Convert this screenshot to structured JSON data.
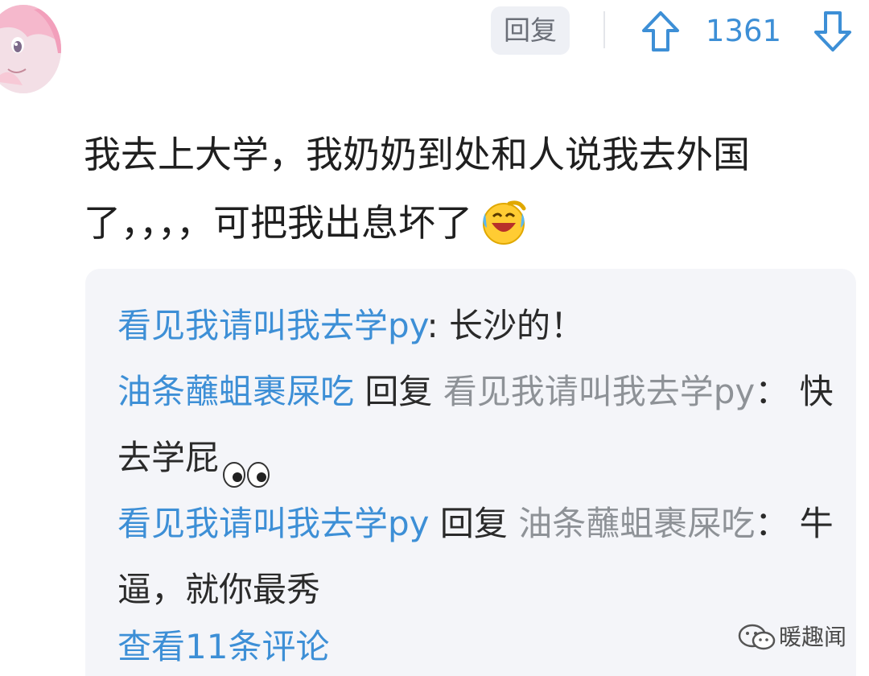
{
  "header": {
    "reply_label": "回复",
    "vote_count": "1361",
    "icons": {
      "avatar": "anime-avatar-pink-hair",
      "upvote": "arrow-up-icon",
      "downvote": "arrow-down-icon"
    }
  },
  "comment": {
    "text": "我去上大学，我奶奶到处和人说我去外国了，，，，可把我出息坏了",
    "emoji": "laughing-tears-emoji"
  },
  "replies": [
    {
      "user": "看见我请叫我去学py",
      "reply_word": "",
      "target": "",
      "text": ":  长沙的！"
    },
    {
      "user": "油条蘸蛆裹屎吃",
      "reply_word": " 回复 ",
      "target": "看见我请叫我去学py",
      "text": "：  快去学屁",
      "emoji": "eyes-emoji"
    },
    {
      "user": "看见我请叫我去学py",
      "reply_word": " 回复 ",
      "target": "油条蘸蛆裹屎吃",
      "text": "：  牛逼，就你最秀"
    }
  ],
  "view_more_label": "查看11条评论",
  "watermark": {
    "text": "暖趣闻",
    "icon": "wechat-official-account-icon"
  },
  "colors": {
    "link_blue": "#3d8fd6",
    "reply_bg": "#f4f5f9",
    "muted_gray": "#8e9297"
  }
}
